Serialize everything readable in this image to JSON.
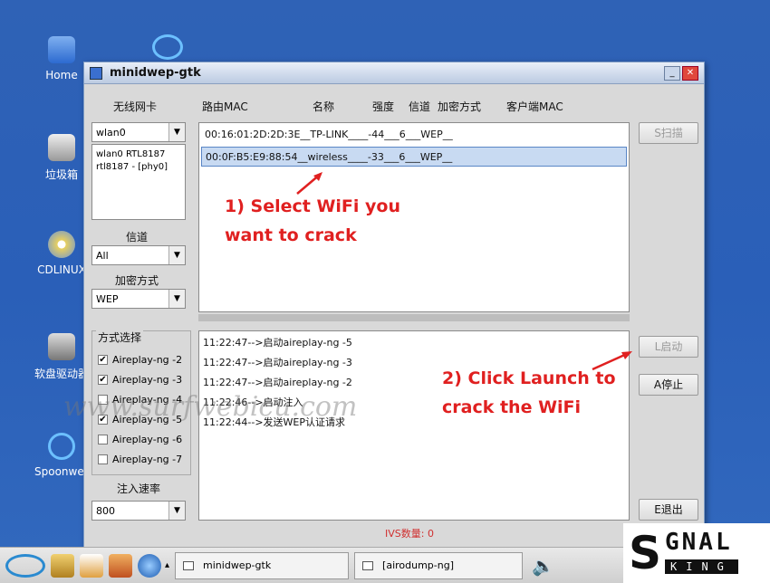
{
  "desktop": {
    "icons": [
      {
        "label": "Home",
        "name": "home-icon"
      },
      {
        "label": "垃圾箱",
        "name": "trash-icon"
      },
      {
        "label": "CDLINUX",
        "name": "cd-icon"
      },
      {
        "label": "软盘驱动器",
        "name": "floppy-icon"
      },
      {
        "label": "Spoonwep",
        "name": "spoonwep-icon"
      }
    ]
  },
  "window": {
    "title": "minidwep-gtk",
    "minimize_glyph": "_",
    "close_glyph": "✕"
  },
  "headers": {
    "nic": "无线网卡",
    "router_mac": "路由MAC",
    "name": "名称",
    "strength": "强度",
    "channel": "信道",
    "encryption": "加密方式",
    "client_mac": "客户端MAC"
  },
  "left": {
    "nic_value": "wlan0",
    "nic_info_line1": "wlan0 RTL8187",
    "nic_info_line2": "rtl8187 - [phy0]",
    "channel_label": "信道",
    "channel_value": "All",
    "enc_label": "加密方式",
    "enc_value": "WEP",
    "method_label": "方式选择",
    "methods": [
      {
        "label": "Aireplay-ng -2",
        "checked": true
      },
      {
        "label": "Aireplay-ng -3",
        "checked": true
      },
      {
        "label": "Aireplay-ng -4",
        "checked": false
      },
      {
        "label": "Aireplay-ng -5",
        "checked": true
      },
      {
        "label": "Aireplay-ng -6",
        "checked": false
      },
      {
        "label": "Aireplay-ng -7",
        "checked": false
      }
    ],
    "rate_label": "注入速率",
    "rate_value": "800"
  },
  "networks": [
    {
      "text": "00:16:01:2D:2D:3E__TP-LINK____-44___6___WEP__",
      "selected": false
    },
    {
      "text": "00:0F:B5:E9:88:54__wireless____-33___6___WEP__",
      "selected": true
    }
  ],
  "log": [
    "11:22:47-->启动aireplay-ng -5",
    "11:22:47-->启动aireplay-ng -3",
    "11:22:47-->启动aireplay-ng -2",
    "11:22:46-->启动注入",
    "11:22:44-->发送WEP认证请求"
  ],
  "buttons": {
    "scan": "S扫描",
    "launch": "L启动",
    "stop": "A停止",
    "exit": "E退出"
  },
  "ivs_status": "IVS数量: 0",
  "annotations": {
    "step1_line1": "1) Select WiFi you",
    "step1_line2": "want to crack",
    "step2_line1": "2) Click Launch to",
    "step2_line2": "crack the WiFi",
    "color": "#e02020"
  },
  "watermark": "www.surfwebicu.com",
  "taskbar": {
    "items": [
      {
        "label": "minidwep-gtk"
      },
      {
        "label": "[airodump-ng]"
      }
    ]
  },
  "logo": {
    "line1": "GNAL",
    "line2": "KING"
  }
}
